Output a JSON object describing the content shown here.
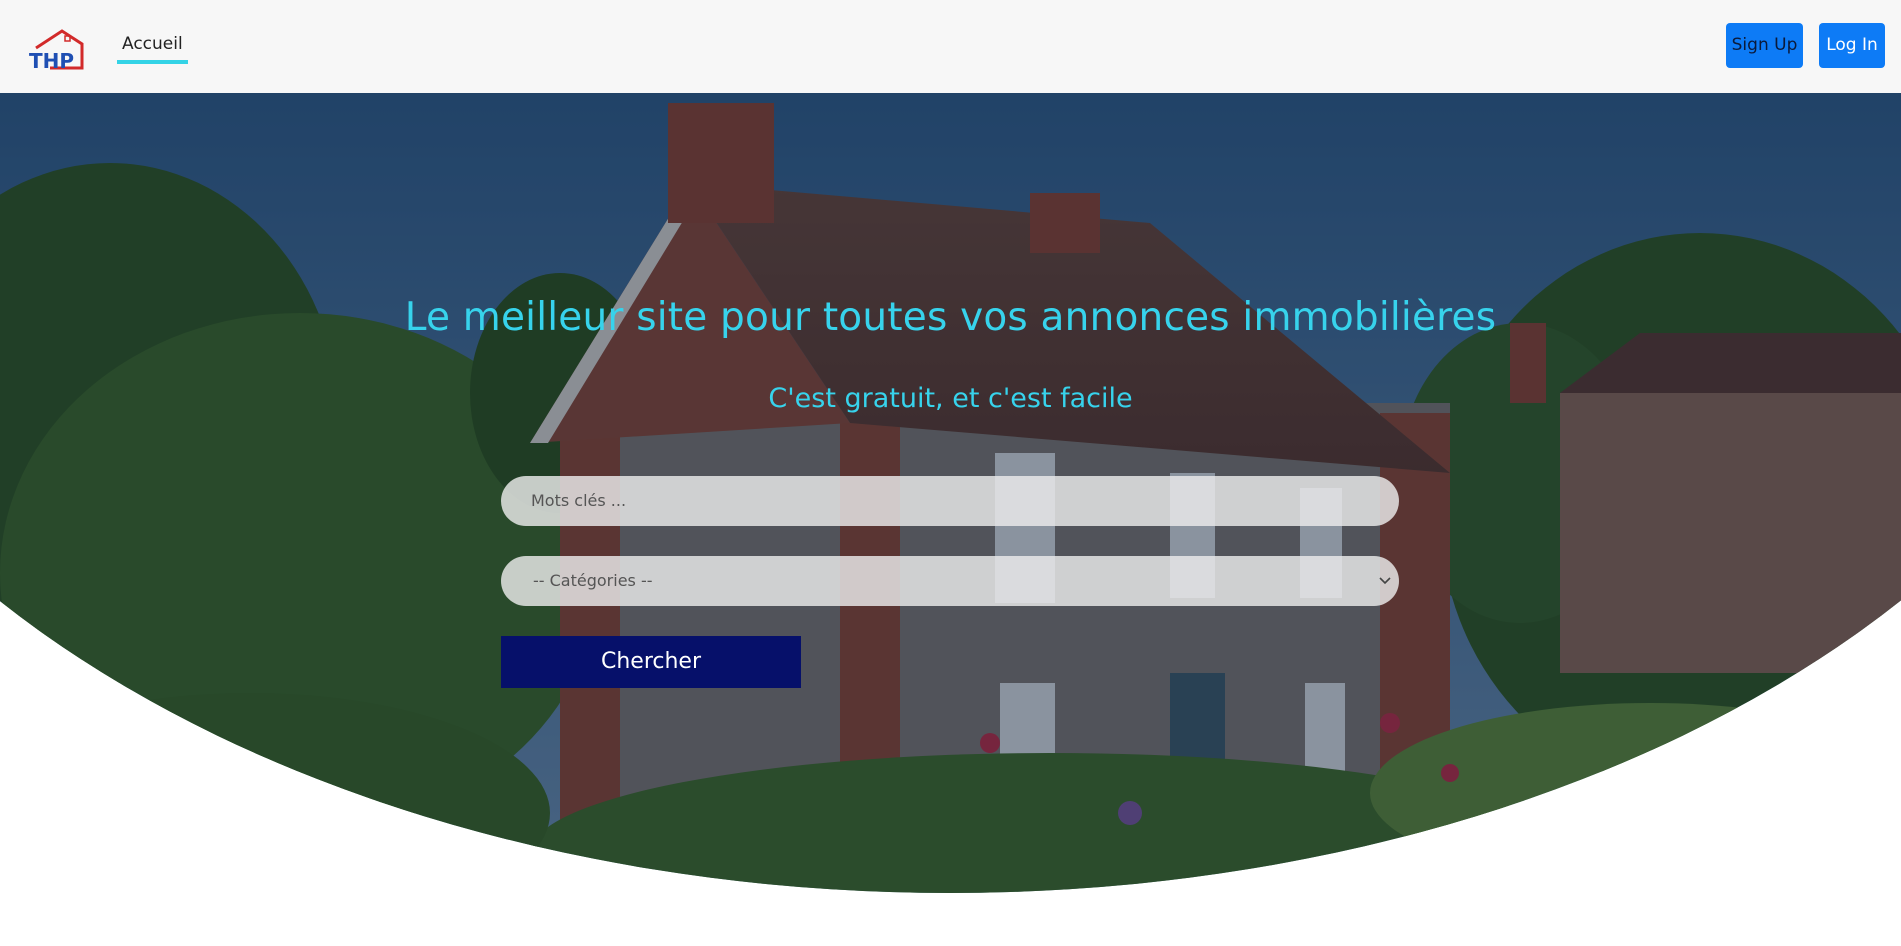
{
  "navbar": {
    "logo_text": "THP",
    "nav_items": [
      {
        "label": "Accueil",
        "active": true
      }
    ],
    "signup_label": "Sign Up",
    "login_label": "Log In"
  },
  "hero": {
    "headline": "Le meilleur site pour toutes vos annonces immobilières",
    "subline": "C'est gratuit, et c'est facile",
    "keywords_placeholder": "Mots clés ...",
    "categories_selected": "-- Catégories --",
    "search_label": "Chercher"
  },
  "colors": {
    "accent": "#37d3ec",
    "primary_button": "#0d7bf6",
    "search_button": "#06106a",
    "navbar_bg": "#f7f7f7",
    "logo_blue": "#1f4fb3",
    "logo_red": "#d22a2a"
  },
  "icons": {
    "logo": "house-logo-icon",
    "select_arrow": "chevron-down-icon"
  }
}
